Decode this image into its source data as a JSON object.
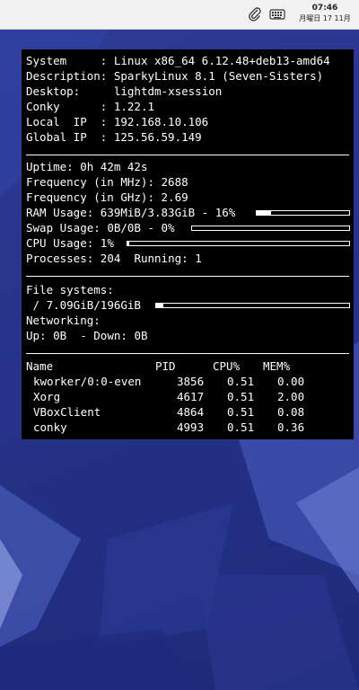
{
  "topbar": {
    "time": "07:46",
    "date": "月曜日 17 11月"
  },
  "conky": {
    "system": {
      "system_label": "System",
      "system_value": "Linux x86_64 6.12.48+deb13-amd64",
      "description_label": "Description:",
      "description_value": "SparkyLinux 8.1 (Seven-Sisters)",
      "desktop_label": "Desktop:",
      "desktop_value": "lightdm-xsession",
      "conky_label": "Conky",
      "conky_value": "1.22.1",
      "local_ip_label": "Local  IP",
      "local_ip_value": "192.168.10.106",
      "global_ip_label": "Global IP",
      "global_ip_value": "125.56.59.149"
    },
    "stats": {
      "uptime_label": "Uptime:",
      "uptime_value": "0h 42m 42s",
      "freq_mhz_label": "Frequency (in MHz):",
      "freq_mhz_value": "2688",
      "freq_ghz_label": "Frequency (in GHz):",
      "freq_ghz_value": "2.69",
      "ram_label": "RAM Usage:",
      "ram_value": "639MiB/3.83GiB - 16%",
      "ram_percent": 16,
      "swap_label": "Swap Usage:",
      "swap_value": "0B/0B - 0%",
      "swap_percent": 0,
      "cpu_label": "CPU Usage:",
      "cpu_value": "1%",
      "cpu_percent": 1,
      "processes_label": "Processes:",
      "processes_value": "204",
      "running_label": "Running:",
      "running_value": "1"
    },
    "fs": {
      "title": "File systems:",
      "root_value": "/ 7.09GiB/196GiB",
      "root_percent": 3.6,
      "networking_label": "Networking:",
      "up_label": "Up:",
      "up_value": "0B",
      "down_label": "- Down:",
      "down_value": "0B"
    },
    "processes": {
      "headers": {
        "name": "Name",
        "pid": "PID",
        "cpu": "CPU%",
        "mem": "MEM%"
      },
      "rows": [
        {
          "name": "kworker/0:0-even",
          "pid": "3856",
          "cpu": "0.51",
          "mem": "0.00"
        },
        {
          "name": "Xorg",
          "pid": "4617",
          "cpu": "0.51",
          "mem": "2.00"
        },
        {
          "name": "VBoxClient",
          "pid": "4864",
          "cpu": "0.51",
          "mem": "0.08"
        },
        {
          "name": "conky",
          "pid": "4993",
          "cpu": "0.51",
          "mem": "0.36"
        }
      ]
    }
  }
}
